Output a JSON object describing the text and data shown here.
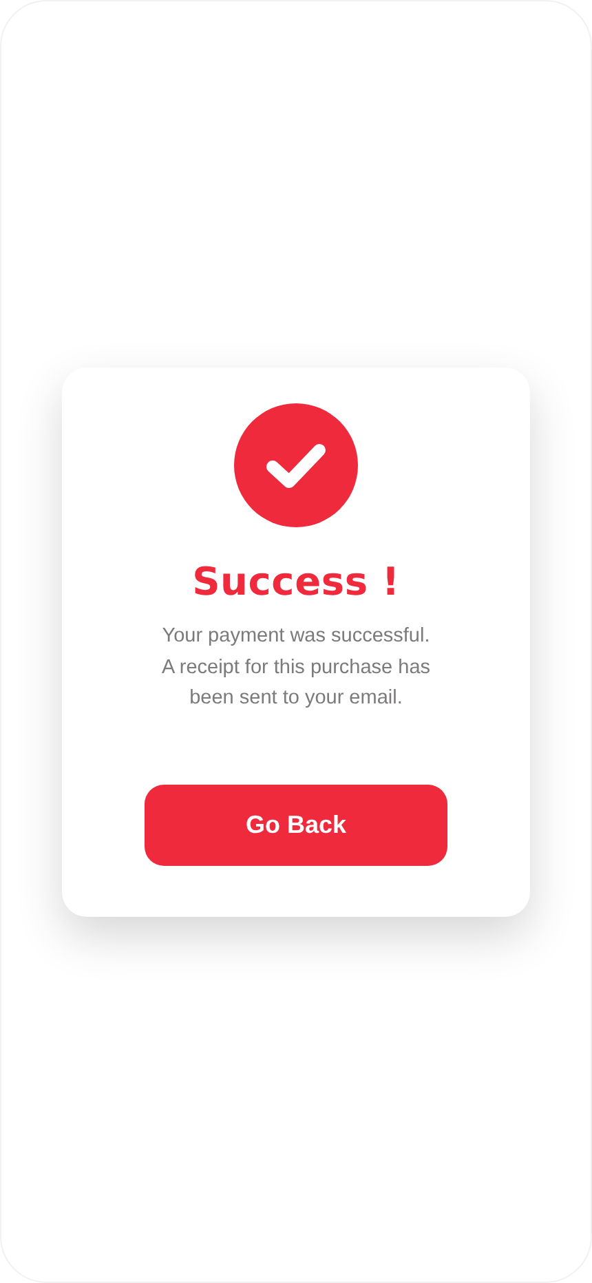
{
  "dialog": {
    "title": "Success !",
    "message": "Your payment was successful.\nA receipt for this purchase has\nbeen sent to your email.",
    "button": "Go Back"
  }
}
